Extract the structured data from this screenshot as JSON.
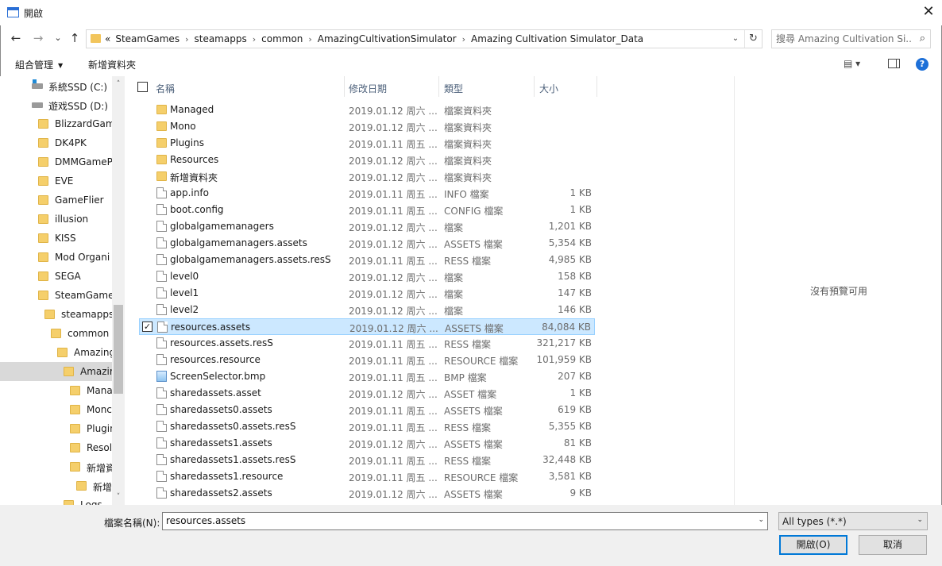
{
  "window": {
    "title": "開啟",
    "close_glyph": "✕"
  },
  "nav": {
    "back": "←",
    "forward": "→",
    "recent": "⌄",
    "up": "↑",
    "breadcrumb": [
      "«",
      "SteamGames",
      "steamapps",
      "common",
      "AmazingCultivationSimulator",
      "Amazing Cultivation Simulator_Data"
    ],
    "separator": "›",
    "dropdown": "⌄",
    "refresh": "↻",
    "search_placeholder": "搜尋 Amazing Cultivation Si...",
    "search_icon": "⌕"
  },
  "toolbar": {
    "organize": "組合管理",
    "new_folder": "新增資料夾",
    "caret": "▼",
    "view_icon": "▤ ▾",
    "help": "?"
  },
  "sidebar": {
    "items": [
      {
        "label": "系統SSD (C:)",
        "icon": "drive-icon",
        "level": 0
      },
      {
        "label": "遊戏SSD (D:)",
        "icon": "drive-icon",
        "level": 0
      },
      {
        "label": "BlizzardGam",
        "icon": "folder-icon",
        "level": 1
      },
      {
        "label": "DK4PK",
        "icon": "folder-icon",
        "level": 1
      },
      {
        "label": "DMMGameP",
        "icon": "folder-icon",
        "level": 1
      },
      {
        "label": "EVE",
        "icon": "folder-icon",
        "level": 1
      },
      {
        "label": "GameFlier",
        "icon": "folder-icon",
        "level": 1
      },
      {
        "label": "illusion",
        "icon": "folder-icon",
        "level": 1
      },
      {
        "label": "KISS",
        "icon": "folder-icon",
        "level": 1
      },
      {
        "label": "Mod Organi",
        "icon": "folder-icon",
        "level": 1
      },
      {
        "label": "SEGA",
        "icon": "folder-icon",
        "level": 1
      },
      {
        "label": "SteamGame",
        "icon": "folder-icon",
        "level": 1
      },
      {
        "label": "steamapps",
        "icon": "folder-icon",
        "level": 2
      },
      {
        "label": "common",
        "icon": "folder-icon",
        "level": 3
      },
      {
        "label": "Amazing",
        "icon": "folder-icon",
        "level": 4
      },
      {
        "label": "Amazir",
        "icon": "folder-icon",
        "level": 5,
        "selected": true
      },
      {
        "label": "Mana",
        "icon": "folder-icon",
        "level": 6
      },
      {
        "label": "Monc",
        "icon": "folder-icon",
        "level": 6
      },
      {
        "label": "Plugin",
        "icon": "folder-icon",
        "level": 6
      },
      {
        "label": "Resol",
        "icon": "folder-icon",
        "level": 6
      },
      {
        "label": "新增資",
        "icon": "folder-icon",
        "level": 6
      },
      {
        "label": "新增",
        "icon": "folder-icon",
        "level": 7
      },
      {
        "label": "Logs",
        "icon": "folder-icon",
        "level": 5
      }
    ],
    "scroll_up": "˄",
    "scroll_down": "˅"
  },
  "columns": {
    "name": "名稱",
    "date": "修改日期",
    "type": "類型",
    "size": "大小",
    "sort_indicator": "˄"
  },
  "files": [
    {
      "name": "Managed",
      "date": "2019.01.12 周六 ...",
      "type": "檔案資料夾",
      "size": "",
      "kind": "folder"
    },
    {
      "name": "Mono",
      "date": "2019.01.12 周六 ...",
      "type": "檔案資料夾",
      "size": "",
      "kind": "folder"
    },
    {
      "name": "Plugins",
      "date": "2019.01.11 周五 ...",
      "type": "檔案資料夾",
      "size": "",
      "kind": "folder"
    },
    {
      "name": "Resources",
      "date": "2019.01.12 周六 ...",
      "type": "檔案資料夾",
      "size": "",
      "kind": "folder"
    },
    {
      "name": "新增資料夾",
      "date": "2019.01.12 周六 ...",
      "type": "檔案資料夾",
      "size": "",
      "kind": "folder"
    },
    {
      "name": "app.info",
      "date": "2019.01.11 周五 ...",
      "type": "INFO 檔案",
      "size": "1 KB",
      "kind": "file"
    },
    {
      "name": "boot.config",
      "date": "2019.01.11 周五 ...",
      "type": "CONFIG 檔案",
      "size": "1 KB",
      "kind": "file"
    },
    {
      "name": "globalgamemanagers",
      "date": "2019.01.12 周六 ...",
      "type": "檔案",
      "size": "1,201 KB",
      "kind": "file"
    },
    {
      "name": "globalgamemanagers.assets",
      "date": "2019.01.12 周六 ...",
      "type": "ASSETS 檔案",
      "size": "5,354 KB",
      "kind": "file"
    },
    {
      "name": "globalgamemanagers.assets.resS",
      "date": "2019.01.11 周五 ...",
      "type": "RESS 檔案",
      "size": "4,985 KB",
      "kind": "file"
    },
    {
      "name": "level0",
      "date": "2019.01.12 周六 ...",
      "type": "檔案",
      "size": "158 KB",
      "kind": "file"
    },
    {
      "name": "level1",
      "date": "2019.01.12 周六 ...",
      "type": "檔案",
      "size": "147 KB",
      "kind": "file"
    },
    {
      "name": "level2",
      "date": "2019.01.12 周六 ...",
      "type": "檔案",
      "size": "146 KB",
      "kind": "file"
    },
    {
      "name": "resources.assets",
      "date": "2019.01.12 周六 ...",
      "type": "ASSETS 檔案",
      "size": "84,084 KB",
      "kind": "file",
      "selected": true
    },
    {
      "name": "resources.assets.resS",
      "date": "2019.01.11 周五 ...",
      "type": "RESS 檔案",
      "size": "321,217 KB",
      "kind": "file"
    },
    {
      "name": "resources.resource",
      "date": "2019.01.11 周五 ...",
      "type": "RESOURCE 檔案",
      "size": "101,959 KB",
      "kind": "file"
    },
    {
      "name": "ScreenSelector.bmp",
      "date": "2019.01.11 周五 ...",
      "type": "BMP 檔案",
      "size": "207 KB",
      "kind": "image"
    },
    {
      "name": "sharedassets.asset",
      "date": "2019.01.12 周六 ...",
      "type": "ASSET 檔案",
      "size": "1 KB",
      "kind": "file"
    },
    {
      "name": "sharedassets0.assets",
      "date": "2019.01.11 周五 ...",
      "type": "ASSETS 檔案",
      "size": "619 KB",
      "kind": "file"
    },
    {
      "name": "sharedassets0.assets.resS",
      "date": "2019.01.11 周五 ...",
      "type": "RESS 檔案",
      "size": "5,355 KB",
      "kind": "file"
    },
    {
      "name": "sharedassets1.assets",
      "date": "2019.01.12 周六 ...",
      "type": "ASSETS 檔案",
      "size": "81 KB",
      "kind": "file"
    },
    {
      "name": "sharedassets1.assets.resS",
      "date": "2019.01.11 周五 ...",
      "type": "RESS 檔案",
      "size": "32,448 KB",
      "kind": "file"
    },
    {
      "name": "sharedassets1.resource",
      "date": "2019.01.11 周五 ...",
      "type": "RESOURCE 檔案",
      "size": "3,581 KB",
      "kind": "file"
    },
    {
      "name": "sharedassets2.assets",
      "date": "2019.01.12 周六 ...",
      "type": "ASSETS 檔案",
      "size": "9 KB",
      "kind": "file"
    }
  ],
  "preview": {
    "message": "沒有預覽可用"
  },
  "bottom": {
    "filename_label": "檔案名稱(N):",
    "filename_value": "resources.assets",
    "filetype_value": "All types (*.*)",
    "dropdown": "⌄",
    "open": "開啟(O)",
    "cancel": "取消"
  },
  "colors": {
    "selection": "#cce8ff",
    "selection_border": "#99d1ff",
    "accent": "#0078d7",
    "folder": "#f5cf6b"
  }
}
